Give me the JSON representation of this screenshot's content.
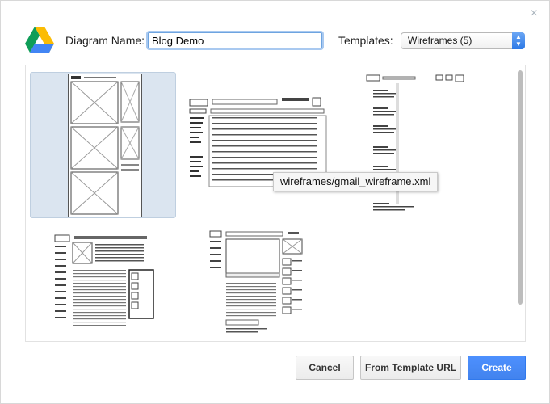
{
  "dialog": {
    "close_glyph": "×",
    "diagram_name_label": "Diagram Name:",
    "diagram_name_value": "Blog Demo",
    "templates_label": "Templates:",
    "templates_selected": "Wireframes (5)",
    "tooltip": "wireframes/gmail_wireframe.xml",
    "buttons": {
      "cancel": "Cancel",
      "from_template_url": "From Template URL",
      "create": "Create"
    }
  },
  "icons": {
    "logo": "google-drive-logo",
    "close": "close-icon",
    "dropdown": "updown-arrows-icon"
  },
  "templates": [
    {
      "name": "blog-wireframe",
      "selected": true
    },
    {
      "name": "gmail-wireframe",
      "selected": false
    },
    {
      "name": "feed-wireframe",
      "selected": false
    },
    {
      "name": "article-wireframe",
      "selected": false
    },
    {
      "name": "video-wireframe",
      "selected": false
    }
  ],
  "colors": {
    "accent": "#4d90fe",
    "selection": "#dbe5f0",
    "input_focus": "#6ea4e0"
  }
}
